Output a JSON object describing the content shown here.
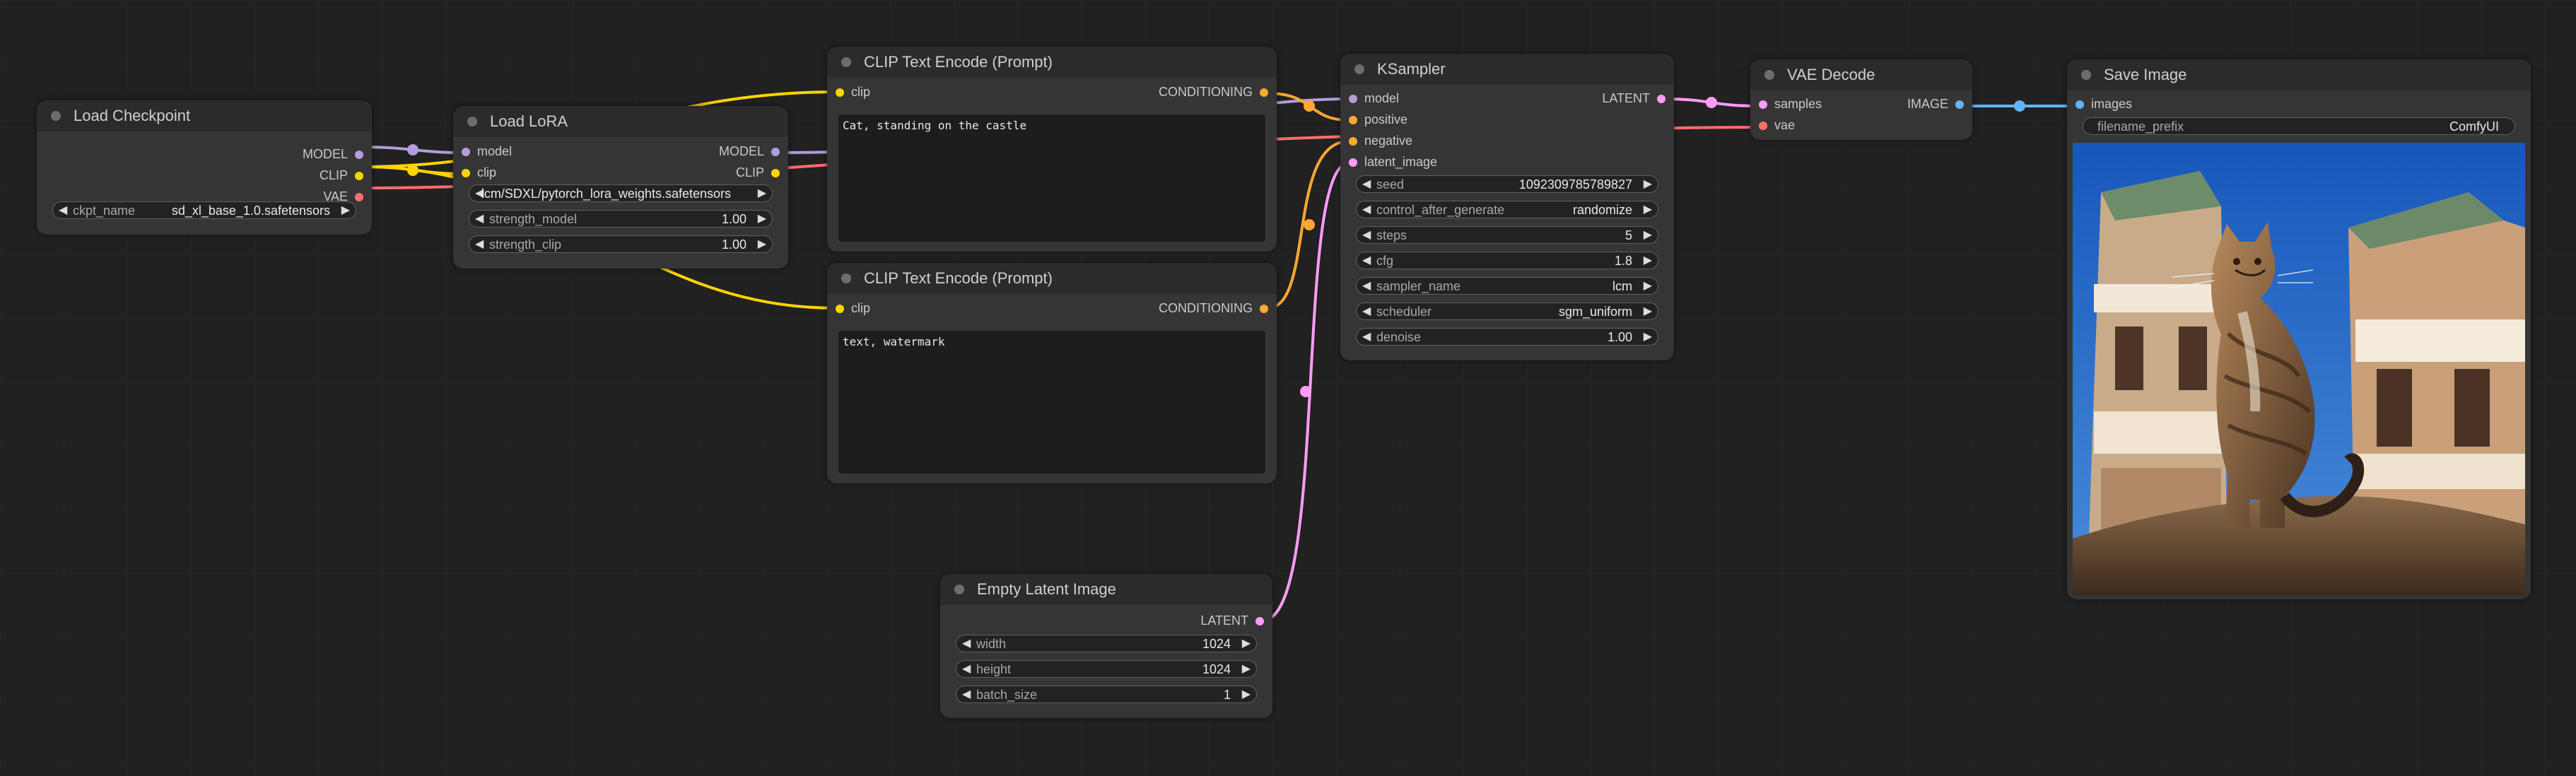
{
  "colors": {
    "model": "#b39ddb",
    "clip": "#ffd500",
    "vae": "#ff6e6e",
    "conditioning": "#ffa931",
    "latent": "#ff9cf9",
    "image": "#64b5f6"
  },
  "nodes": {
    "load_checkpoint": {
      "title": "Load Checkpoint",
      "outputs": [
        "MODEL",
        "CLIP",
        "VAE"
      ],
      "ckpt_name_label": "ckpt_name",
      "ckpt_name_value": "sd_xl_base_1.0.safetensors"
    },
    "load_lora": {
      "title": "Load LoRA",
      "inputs": [
        "model",
        "clip"
      ],
      "outputs": [
        "MODEL",
        "CLIP"
      ],
      "lora_name_value": "lcm/SDXL/pytorch_lora_weights.safetensors",
      "strength_model_label": "strength_model",
      "strength_model_value": "1.00",
      "strength_clip_label": "strength_clip",
      "strength_clip_value": "1.00"
    },
    "clip_pos": {
      "title": "CLIP Text Encode (Prompt)",
      "input": "clip",
      "output": "CONDITIONING",
      "text": "Cat, standing on the castle"
    },
    "clip_neg": {
      "title": "CLIP Text Encode (Prompt)",
      "input": "clip",
      "output": "CONDITIONING",
      "text": "text, watermark"
    },
    "ksampler": {
      "title": "KSampler",
      "inputs": [
        "model",
        "positive",
        "negative",
        "latent_image"
      ],
      "output": "LATENT",
      "widgets": [
        {
          "name": "seed",
          "value": "1092309785789827"
        },
        {
          "name": "control_after_generate",
          "value": "randomize"
        },
        {
          "name": "steps",
          "value": "5"
        },
        {
          "name": "cfg",
          "value": "1.8"
        },
        {
          "name": "sampler_name",
          "value": "lcm"
        },
        {
          "name": "scheduler",
          "value": "sgm_uniform"
        },
        {
          "name": "denoise",
          "value": "1.00"
        }
      ]
    },
    "vae_decode": {
      "title": "VAE Decode",
      "inputs": [
        "samples",
        "vae"
      ],
      "output": "IMAGE"
    },
    "save_image": {
      "title": "Save Image",
      "input": "images",
      "filename_prefix_label": "filename_prefix",
      "filename_prefix_value": "ComfyUI"
    },
    "empty_latent": {
      "title": "Empty Latent Image",
      "output": "LATENT",
      "widgets": [
        {
          "name": "width",
          "value": "1024"
        },
        {
          "name": "height",
          "value": "1024"
        },
        {
          "name": "batch_size",
          "value": "1"
        }
      ]
    }
  },
  "icons": {
    "arrow_left": "◀",
    "arrow_right": "▶"
  }
}
